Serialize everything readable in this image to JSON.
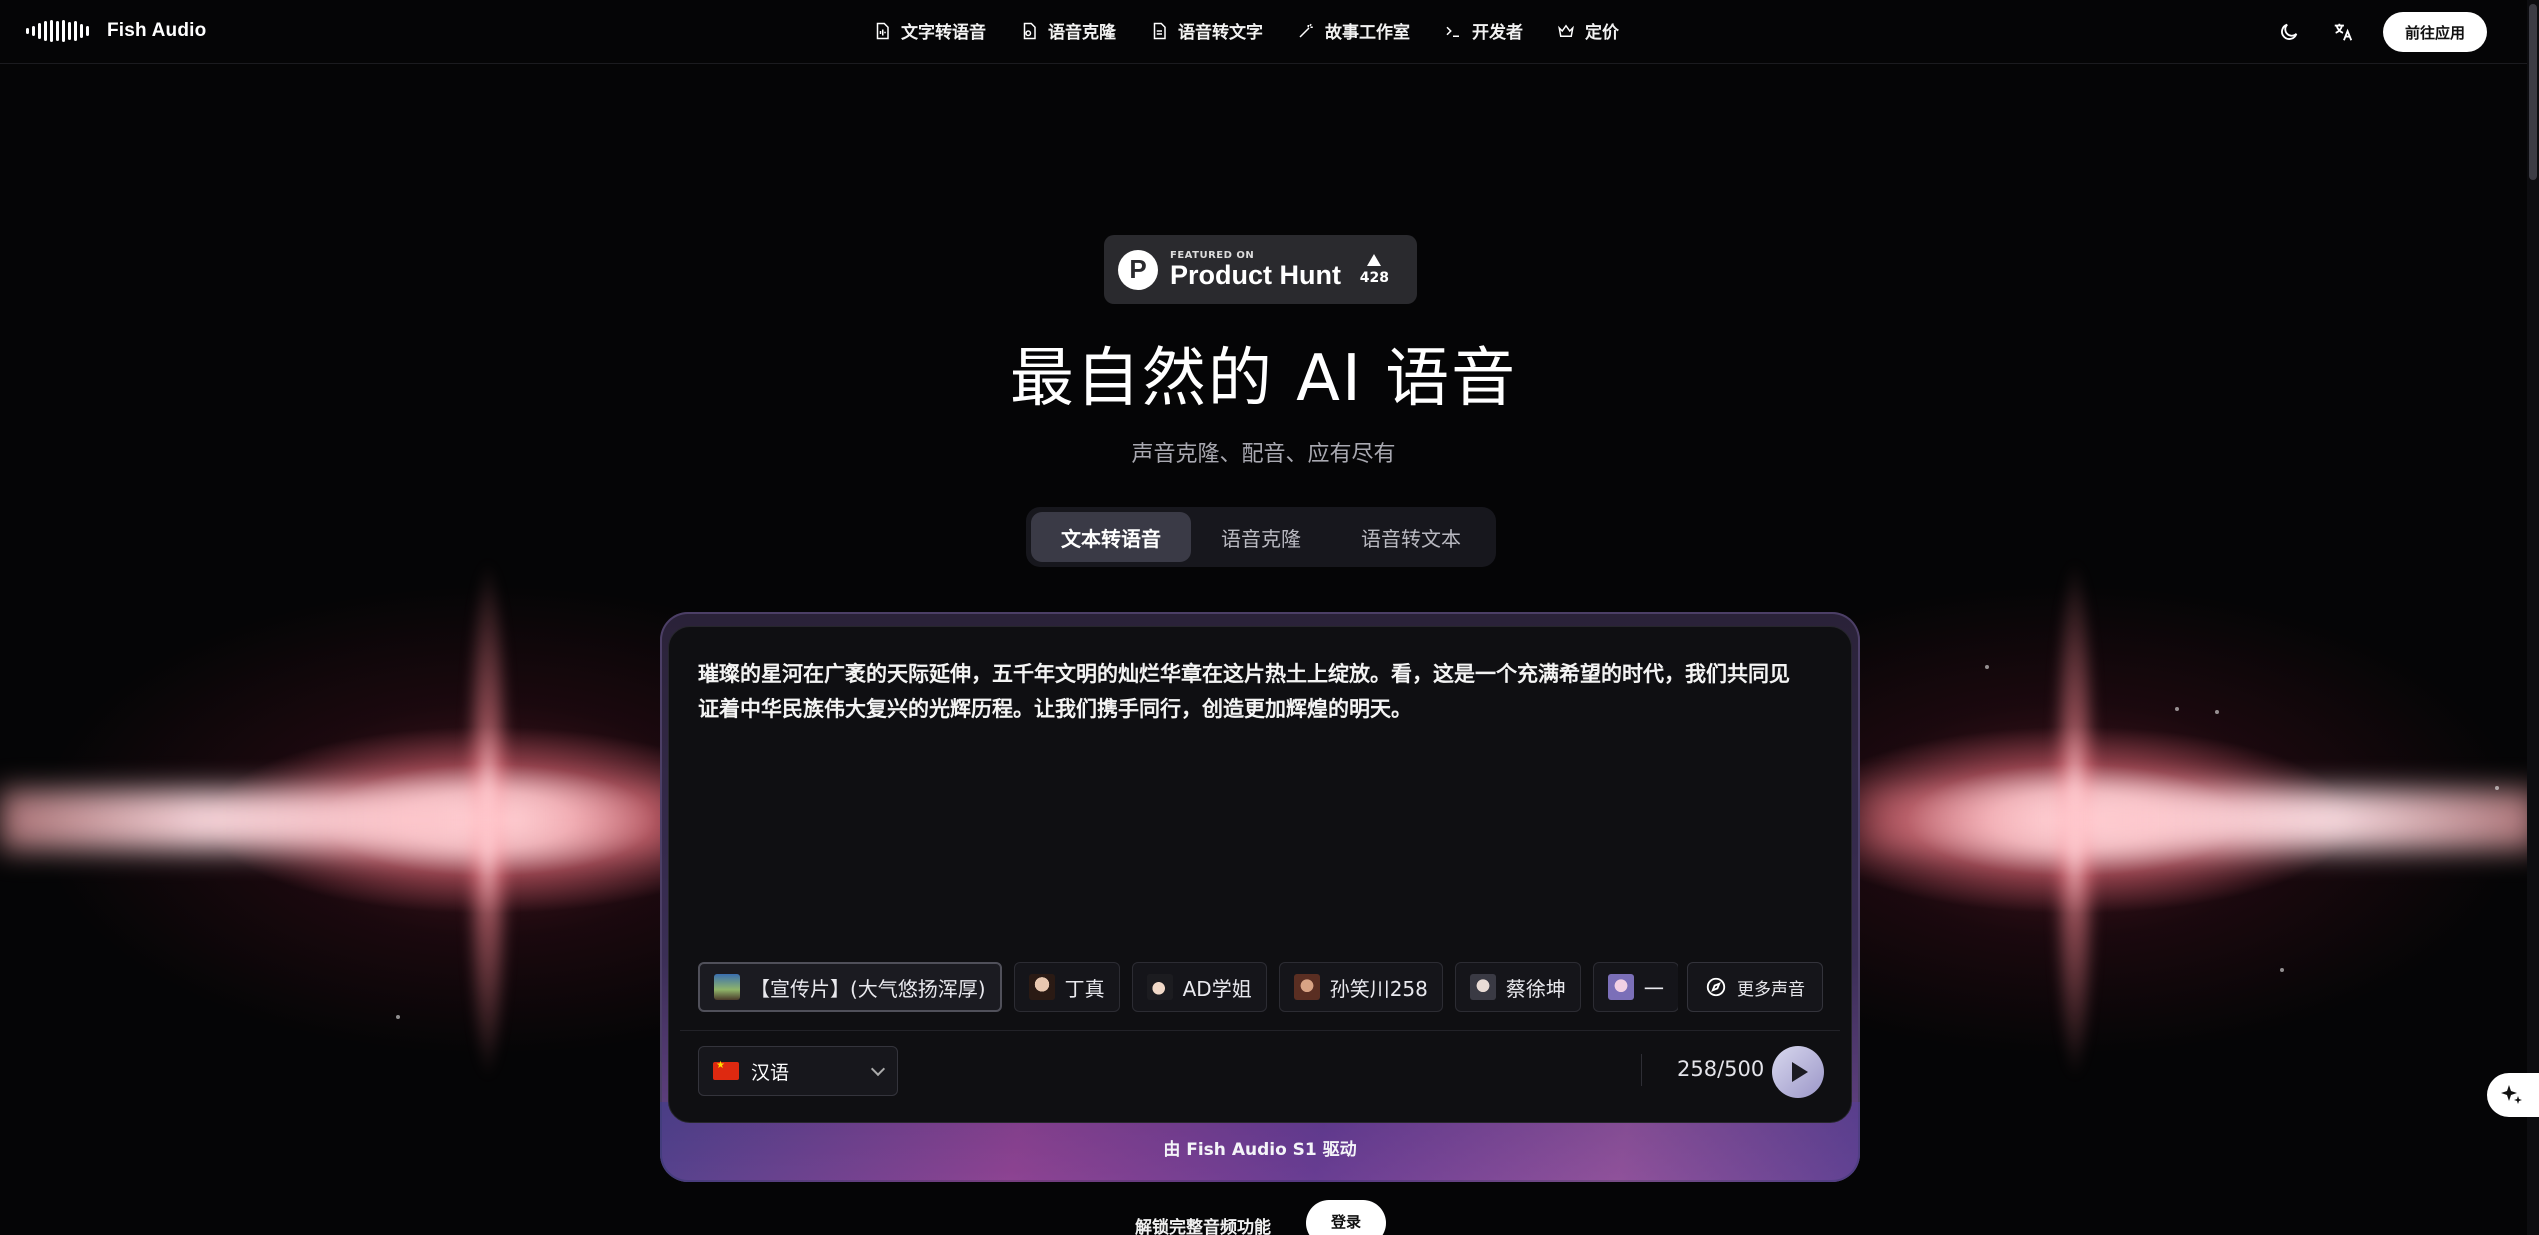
{
  "brand": {
    "name": "Fish Audio"
  },
  "nav": {
    "items": [
      {
        "label": "文字转语音",
        "icon": "document-audio-icon"
      },
      {
        "label": "语音克隆",
        "icon": "clone-file-icon"
      },
      {
        "label": "语音转文字",
        "icon": "document-text-icon"
      },
      {
        "label": "故事工作室",
        "icon": "magic-wand-icon"
      },
      {
        "label": "开发者",
        "icon": "terminal-icon"
      },
      {
        "label": "定价",
        "icon": "crown-icon"
      }
    ],
    "theme_icon": "moon-icon",
    "language_icon": "translate-icon",
    "cta_label": "前往应用"
  },
  "product_hunt": {
    "featured_on": "FEATURED ON",
    "name": "Product Hunt",
    "votes": "428"
  },
  "hero": {
    "title": "最自然的 AI 语音",
    "subtitle": "声音克隆、配音、应有尽有"
  },
  "mode_tabs": [
    {
      "label": "文本转语音",
      "active": true
    },
    {
      "label": "语音克隆",
      "active": false
    },
    {
      "label": "语音转文本",
      "active": false
    }
  ],
  "tts": {
    "text": "璀璨的星河在广袤的天际延伸，五千年文明的灿烂华章在这片热土上绽放。看，这是一个充满希望的时代，我们共同见证着中华民族伟大复兴的光辉历程。让我们携手同行，创造更加辉煌的明天。",
    "voices": [
      {
        "label": "【宣传片】(大气悠扬浑厚)",
        "selected": true
      },
      {
        "label": "丁真",
        "selected": false
      },
      {
        "label": "AD学姐",
        "selected": false
      },
      {
        "label": "孙笑川258",
        "selected": false
      },
      {
        "label": "蔡徐坤",
        "selected": false
      },
      {
        "label": "一",
        "selected": false
      }
    ],
    "more_voices_label": "更多声音",
    "language": "汉语",
    "char_count": "258/500",
    "powered_by": "由 Fish Audio S1 驱动"
  },
  "footer_cta": {
    "text": "解锁完整音频功能",
    "login_label": "登录"
  },
  "colors": {
    "background": "#050506",
    "accent_glow": "#ff8a96",
    "card_border": "#4c3f66"
  }
}
